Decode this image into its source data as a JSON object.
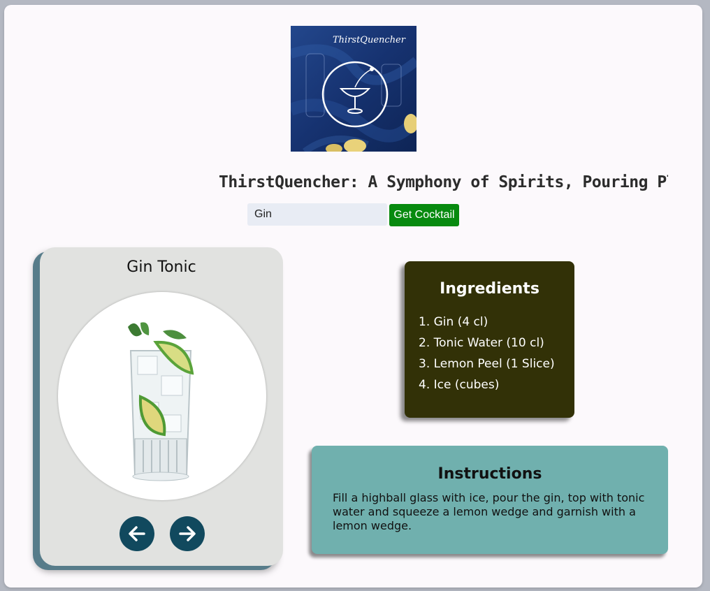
{
  "logo": {
    "text": "ThirstQuencher",
    "icon": "cocktail-glass-logo"
  },
  "headline": "ThirstQuencher: A Symphony of Spirits, Pouring Pleasure",
  "search": {
    "value": "Gin",
    "button_label": "Get Cocktail"
  },
  "drink": {
    "name": "Gin Tonic",
    "image": "gin-tonic-glass"
  },
  "navigation": {
    "prev_icon": "arrow-left-icon",
    "next_icon": "arrow-right-icon"
  },
  "ingredients": {
    "title": "Ingredients",
    "items": [
      "1. Gin (4 cl)",
      "2. Tonic Water (10 cl)",
      "3. Lemon Peel (1 Slice)",
      "4. Ice (cubes)"
    ]
  },
  "instructions": {
    "title": "Instructions",
    "text": "Fill a highball glass with ice, pour the gin, top with tonic water and squeeze a lemon wedge and garnish with a lemon wedge."
  },
  "colors": {
    "button_green": "#078a0f",
    "ingredients_bg": "#323107",
    "instructions_bg": "#70b0ae",
    "nav_button": "#11495e",
    "card_bg": "#e1e2e0"
  }
}
